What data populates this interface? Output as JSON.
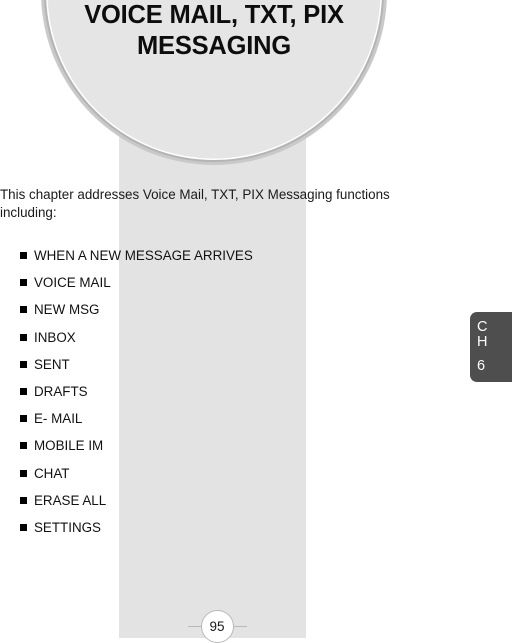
{
  "banner": {
    "title_line1": "VOICE MAIL, TXT, PIX",
    "title_line2": "MESSAGING",
    "background_color": "#e5e5e5",
    "border_color": "#b4b4b4"
  },
  "decor": {
    "band_color": "#e3e3e3"
  },
  "body": {
    "intro_line1": "This chapter addresses Voice Mail, TXT, PIX Messaging functions",
    "intro_line2": "including:"
  },
  "feature_list": [
    {
      "label": "WHEN A NEW MESSAGE ARRIVES"
    },
    {
      "label": "VOICE MAIL"
    },
    {
      "label": "NEW MSG"
    },
    {
      "label": "INBOX"
    },
    {
      "label": "SENT"
    },
    {
      "label": "DRAFTS"
    },
    {
      "label": "E- MAIL"
    },
    {
      "label": "MOBILE IM"
    },
    {
      "label": "CHAT"
    },
    {
      "label": "ERASE ALL"
    },
    {
      "label": "SETTINGS"
    }
  ],
  "chapter_tab": {
    "letter_c": "C",
    "letter_h": "H",
    "number": "6",
    "background_color": "#4e4e4e",
    "text_color": "#ffffff"
  },
  "footer": {
    "page_number": "95"
  }
}
